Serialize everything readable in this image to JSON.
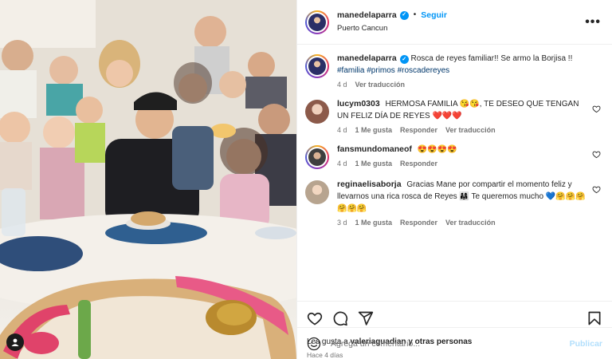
{
  "header": {
    "username": "manedelaparra",
    "follow_label": "Seguir",
    "separator": "•",
    "location": "Puerto Cancun",
    "more_label": "•••"
  },
  "caption": {
    "username": "manedelaparra",
    "text": "Rosca de reyes familiar!! Se armo la Borjisa !!",
    "hashtags": "#familia #primos #roscadereyes",
    "age": "4 d",
    "translate_label": "Ver traducción"
  },
  "comments": [
    {
      "username": "lucym0303",
      "text": "HERMOSA FAMILIA 😘😘, TE DESEO QUE TENGAN UN FELIZ DÍA DE REYES ❤️❤️❤️",
      "age": "4 d",
      "likes": "1 Me gusta",
      "reply": "Responder",
      "translate": "Ver traducción"
    },
    {
      "username": "fansmundomaneof",
      "text": "😍😍😍😍",
      "age": "4 d",
      "likes": "1 Me gusta",
      "reply": "Responder",
      "translate": ""
    },
    {
      "username": "reginaelisaborja",
      "text": "Gracias Mane por compartir el momento feliz y llevarnos una rica rosca de Reyes 👨‍👩‍👧 Te queremos mucho 💙🤗🤗🤗🤗🤗🤗",
      "age": "3 d",
      "likes": "1 Me gusta",
      "reply": "Responder",
      "translate": "Ver traducción"
    }
  ],
  "actions": {
    "icons": [
      "heart-icon",
      "comment-icon",
      "share-icon",
      "bookmark-icon"
    ]
  },
  "likes": {
    "prefix": "Les gusta a",
    "user": "valeriaguadian",
    "suffix": "y otras personas"
  },
  "date": "Hace 4 días",
  "add_comment": {
    "placeholder": "Agrega un comentario...",
    "publish_label": "Publicar"
  },
  "colors": {
    "accent": "#0095f6",
    "publish_disabled": "#b2dffc",
    "hashtag": "#00376b",
    "heart_red": "#ed4956"
  }
}
